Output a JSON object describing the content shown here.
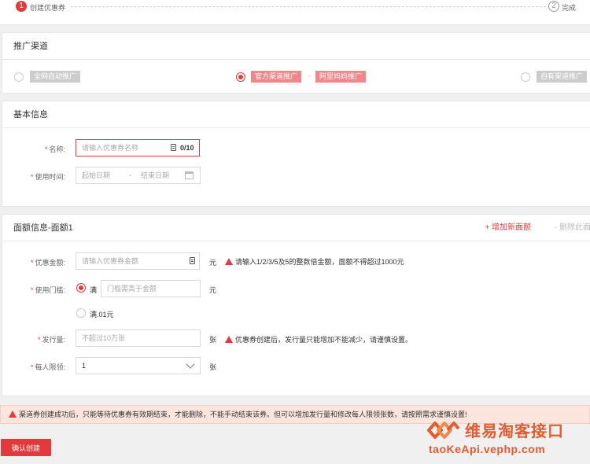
{
  "steps": {
    "step1_num": "1",
    "step1_label": "创建优惠券",
    "step2_num": "2",
    "step2_label": "完成"
  },
  "channel": {
    "title": "推广渠道",
    "options": [
      "全网自动推广",
      "官方渠道推广",
      "阿里妈妈推广",
      "自有渠道推广"
    ],
    "separator": "-",
    "selected": "官方渠道推广"
  },
  "basic": {
    "title": "基本信息",
    "required_mark": "*",
    "name_label": "名称:",
    "name_placeholder": "请输入优惠券名称",
    "name_counter": "0/10",
    "time_label": "使用时间:",
    "start_placeholder": "起始日期",
    "range_sep": "-",
    "end_placeholder": "结束日期"
  },
  "amount": {
    "title": "面额信息-面额1",
    "add_label": "+ 增加新面额",
    "delete_label": "- 删除此面额",
    "required_mark": "*",
    "amount_label": "优惠金额:",
    "amount_placeholder": "请输入优惠券金额",
    "unit_yuan": "元",
    "amount_warning": "请输入1/2/3/5及5的整数倍金额，面额不得超过1000元",
    "threshold_label": "使用门槛:",
    "threshold_full": "满",
    "threshold_placeholder": "门槛需高于金额",
    "threshold_alt": "满.01元",
    "issue_label": "发行量:",
    "issue_placeholder": "不超过10万张",
    "unit_zhang": "张",
    "issue_warning": "优惠券创建后，发行量只能增加不能减少，请谨慎设置。",
    "limit_label": "每人限领:",
    "limit_value": "1"
  },
  "notice": "渠道券创建成功后，只能等待优惠券有效期结束，才能删除，不能手动结束该券。但可以增加发行量和修改每人限领张数，请按照需求谨慎设置!",
  "confirm_label": "确认创建",
  "watermark": {
    "name": "维易淘客接口",
    "url": "taoKeApi.vephp.com"
  },
  "colors": {
    "accent": "#e4393c",
    "tag_selected": "#f3868a",
    "tag_disabled": "#cccccc",
    "notice_bg": "#fbe5dd",
    "brand": "#e65a2e"
  }
}
